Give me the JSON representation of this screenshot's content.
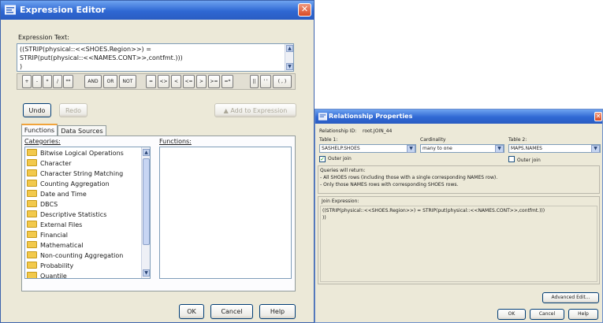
{
  "expression_editor": {
    "title": "Expression Editor",
    "expression_text_label": "Expression Text:",
    "expression_lines": [
      "((STRIP(physical::<<SHOES.Region>>) =",
      "STRIP(put(physical::<<NAMES.CONT>>,contfmt.)))",
      ")"
    ],
    "operator_buttons": [
      "+",
      "-",
      "*",
      "/",
      "**"
    ],
    "logic_buttons": [
      "AND",
      "OR",
      "NOT"
    ],
    "compare_buttons": [
      "=",
      "<>",
      "<",
      "<=",
      ">",
      ">=",
      "=*"
    ],
    "misc_buttons": [
      "||",
      "' '",
      "( , )"
    ],
    "undo_label": "Undo",
    "redo_label": "Redo",
    "add_label": "Add to Expression",
    "tabs": [
      "Functions",
      "Data Sources"
    ],
    "categories_label": "Categories:",
    "functions_label": "Functions:",
    "categories": [
      "Bitwise Logical Operations",
      "Character",
      "Character String Matching",
      "Counting Aggregation",
      "Date and Time",
      "DBCS",
      "Descriptive Statistics",
      "External Files",
      "Financial",
      "Mathematical",
      "Non-counting Aggregation",
      "Probability",
      "Quantile"
    ],
    "ok_label": "OK",
    "cancel_label": "Cancel",
    "help_label": "Help"
  },
  "relationship_properties": {
    "title": "Relationship Properties",
    "relationship_id_label": "Relationship ID:",
    "relationship_id_value": "root.JOIN_44",
    "table1_label": "Table 1:",
    "table1_value": "SASHELP.SHOES",
    "cardinality_label": "Cardinality",
    "cardinality_value": "many to one",
    "table2_label": "Table 2:",
    "table2_value": "MAPS.NAMES",
    "outer_join_label": "Outer join",
    "outer_join_left_checked": true,
    "outer_join_right_checked": false,
    "queries_label": "Queries will return:",
    "queries_lines": [
      "- All SHOES rows (including those with a single corresponding NAMES row).",
      "- Only those NAMES rows with corresponding SHOES rows."
    ],
    "join_expression_label": "Join Expression:",
    "join_expression_lines": [
      "((STRIP(physical::<<SHOES.Region>>) = STRIP(put(physical::<<NAMES.CONT>>,contfmt.)))",
      "))"
    ],
    "advanced_edit_label": "Advanced Edit...",
    "ok_label": "OK",
    "cancel_label": "Cancel",
    "help_label": "Help"
  }
}
